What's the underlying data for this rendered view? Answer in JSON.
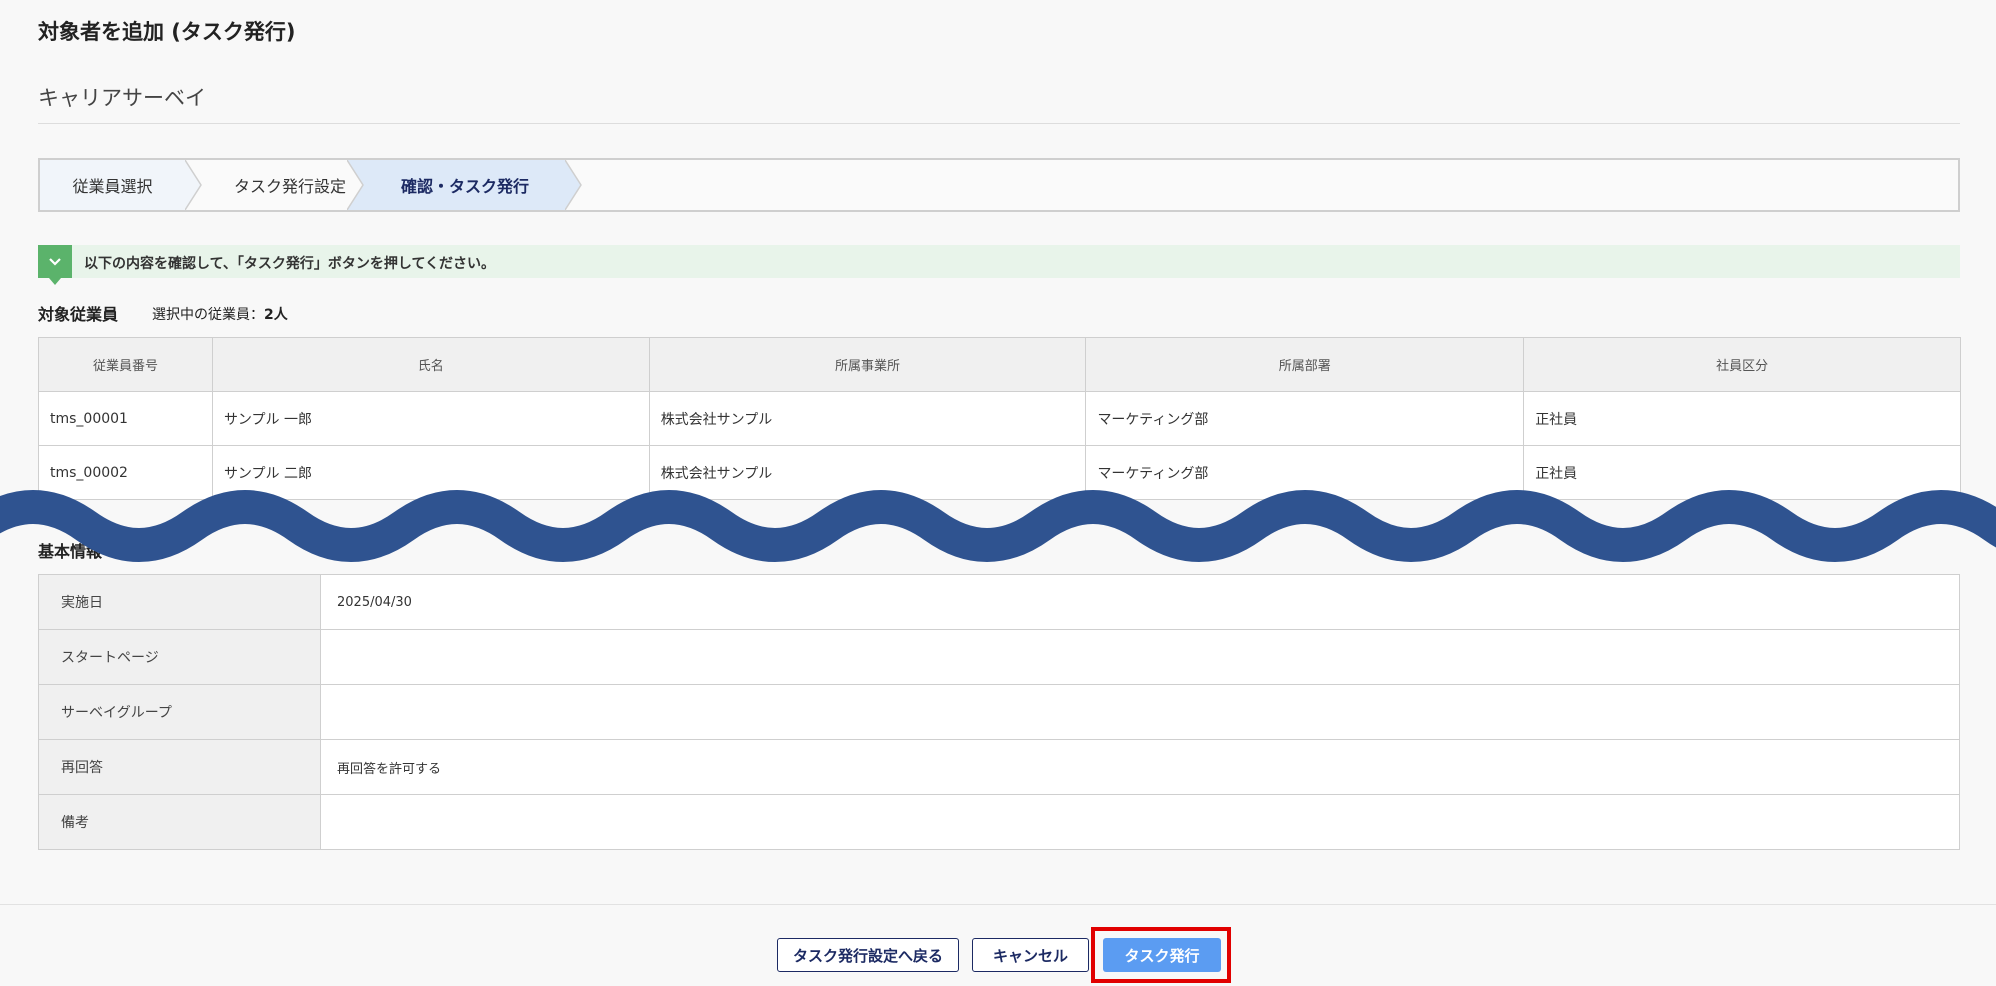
{
  "header": {
    "title": "対象者を追加 (タスク発行)",
    "survey_name": "キャリアサーベイ"
  },
  "stepper": {
    "steps": [
      {
        "label": "従業員選択",
        "state": "done"
      },
      {
        "label": "タスク発行設定",
        "state": "done"
      },
      {
        "label": "確認・タスク発行",
        "state": "current"
      }
    ]
  },
  "notice": {
    "icon": "chevron-down-icon",
    "text": "以下の内容を確認して、「タスク発行」ボタンを押してください。",
    "color": "#5bb36b"
  },
  "employees": {
    "heading": "対象従業員",
    "selected_label": "選択中の従業員：",
    "selected_count": "2人",
    "columns": [
      "従業員番号",
      "氏名",
      "所属事業所",
      "所属部署",
      "社員区分"
    ],
    "rows": [
      [
        "tms_00001",
        "サンプル 一郎",
        "株式会社サンプル",
        "マーケティング部",
        "正社員"
      ],
      [
        "tms_00002",
        "サンプル 二郎",
        "株式会社サンプル",
        "マーケティング部",
        "正社員"
      ]
    ]
  },
  "basic_info": {
    "heading": "基本情報",
    "rows": [
      {
        "label": "実施日",
        "value": "2025/04/30"
      },
      {
        "label": "スタートページ",
        "value": ""
      },
      {
        "label": "サーベイグループ",
        "value": ""
      },
      {
        "label": "再回答",
        "value": "再回答を許可する"
      },
      {
        "label": "備考",
        "value": ""
      }
    ]
  },
  "footer": {
    "back_label": "タスク発行設定へ戻る",
    "cancel_label": "キャンセル",
    "submit_label": "タスク発行",
    "primary_color": "#5b9cf2",
    "highlight_color": "#e10000"
  },
  "divider_color": "#2f5390"
}
